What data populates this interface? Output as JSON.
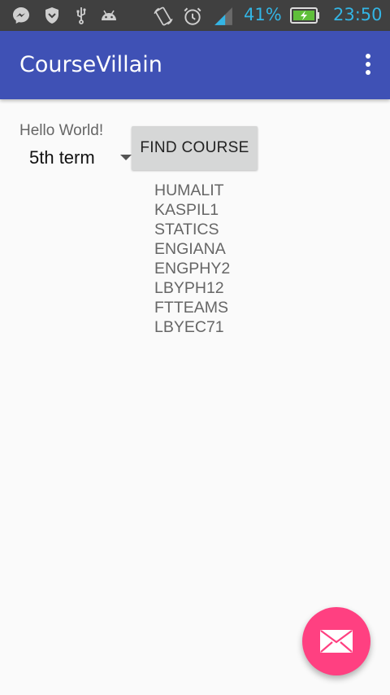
{
  "status_bar": {
    "battery_percent": "41%",
    "time": "23:50",
    "icons": [
      "messenger-icon",
      "shield-icon",
      "usb-icon",
      "android-debug-icon",
      "screen-rotate-icon",
      "alarm-icon",
      "signal-icon",
      "battery-charging-icon"
    ]
  },
  "app_bar": {
    "title": "CourseVillain",
    "overflow_icon": "more-vert-icon"
  },
  "main": {
    "hello_text": "Hello World!",
    "term_spinner": {
      "selected": "5th term"
    },
    "find_button_label": "FIND COURSE",
    "courses": [
      "HUMALIT",
      "KASPIL1",
      "STATICS",
      "ENGIANA",
      "ENGPHY2",
      "LBYPH12",
      "FTTEAMS",
      "LBYEC71"
    ]
  },
  "fab": {
    "icon": "mail-icon",
    "color": "#ff4081"
  },
  "colors": {
    "primary": "#3f51b5",
    "accent": "#ff4081",
    "status_text": "#33b5e5"
  }
}
